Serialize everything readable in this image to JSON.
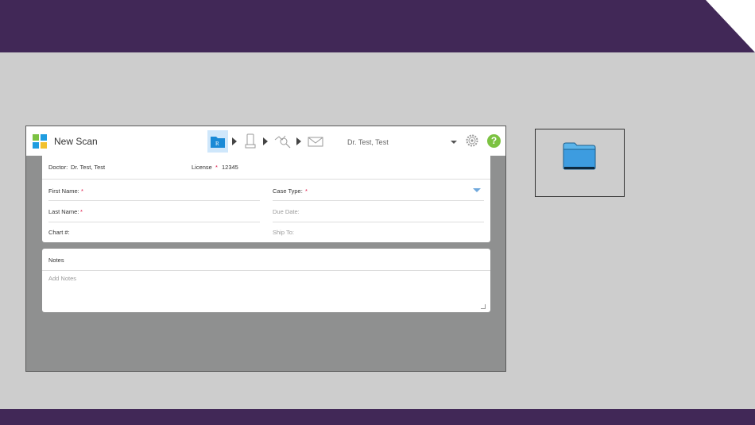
{
  "app": {
    "title": "New Scan",
    "doctor_select": "Dr. Test, Test"
  },
  "icons": {
    "logo": "windows-tiles-icon",
    "step1": "rx-folder-icon",
    "step2": "scanner-icon",
    "step3": "view-icon",
    "step4": "send-envelope-icon",
    "settings": "gear-icon",
    "help": "help-icon",
    "folder": "folder-icon"
  },
  "help_label": "?",
  "form": {
    "doctor_label": "Doctor:",
    "doctor_value": "Dr. Test, Test",
    "license_label": "License",
    "license_required": "*",
    "license_value": "12345",
    "first_name_label": "First Name:",
    "last_name_label": "Last Name:",
    "chart_label": "Chart #:",
    "case_type_label": "Case Type:",
    "due_date_label": "Due Date:",
    "ship_to_label": "Ship To:",
    "required_mark": "*"
  },
  "notes": {
    "title": "Notes",
    "placeholder": "Add Notes"
  },
  "colors": {
    "band": "#412857",
    "background": "#cdcdcd",
    "app_body": "#8f9090",
    "active_step": "#cfe7fb",
    "help": "#7cc242",
    "folder": "#3d9ce0"
  }
}
